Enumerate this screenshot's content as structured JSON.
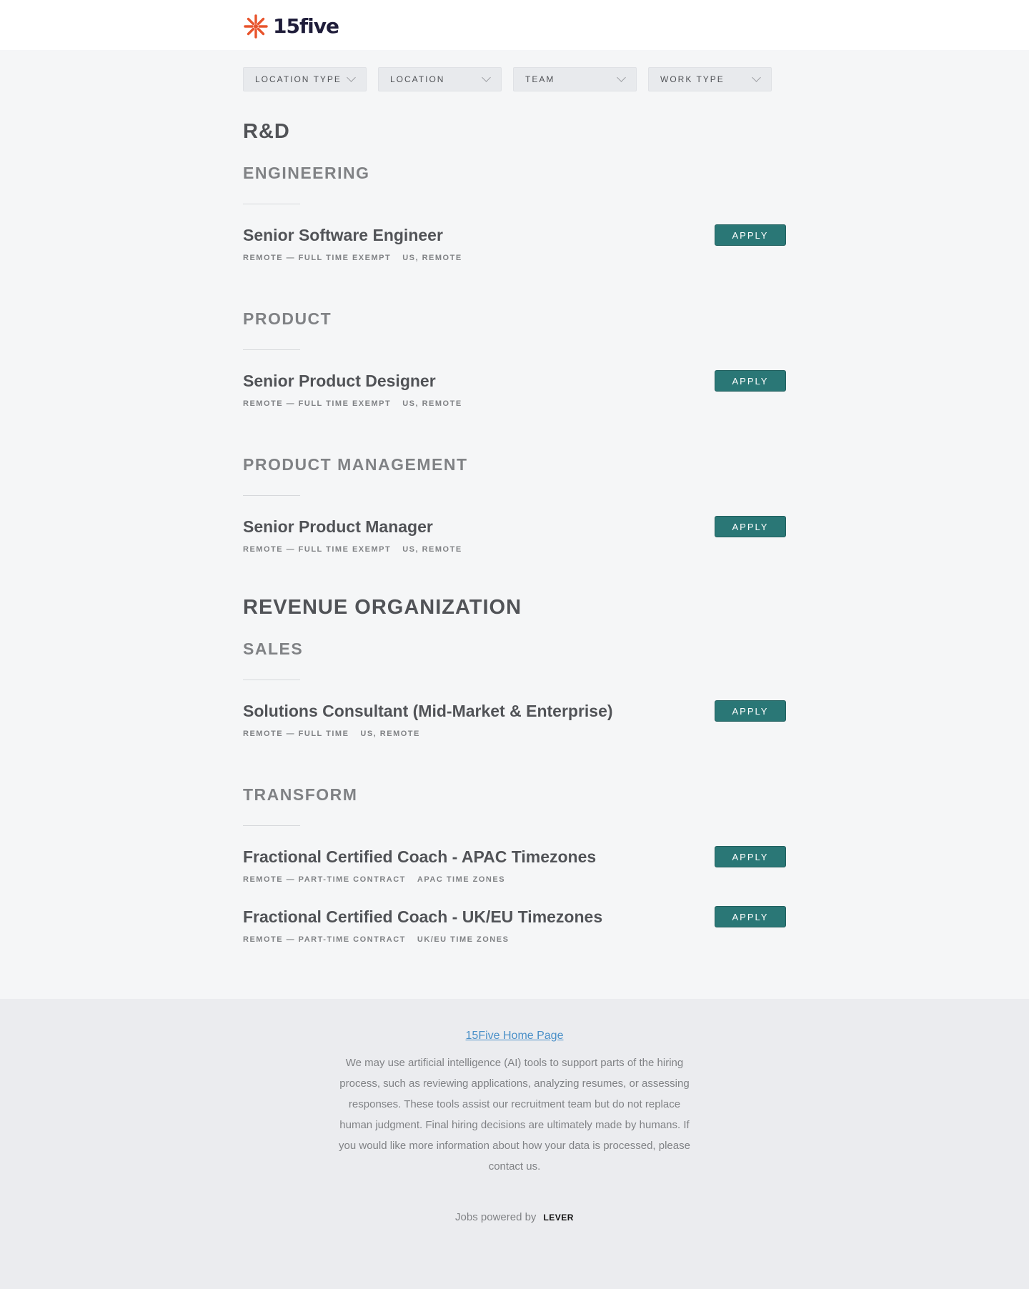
{
  "brand": {
    "name": "15five",
    "accent": "#e8542c"
  },
  "filters": [
    {
      "label": "LOCATION TYPE",
      "icon": "chevron-down-icon"
    },
    {
      "label": "LOCATION",
      "icon": "chevron-down-icon"
    },
    {
      "label": "TEAM",
      "icon": "chevron-down-icon"
    },
    {
      "label": "WORK TYPE",
      "icon": "chevron-down-icon"
    }
  ],
  "groups": [
    {
      "title": "R&D",
      "sections": [
        {
          "title": "ENGINEERING",
          "postings": [
            {
              "name": "Senior Software Engineer",
              "commitment": "REMOTE — FULL TIME EXEMPT",
              "location": "US, REMOTE",
              "apply": "APPLY"
            }
          ]
        },
        {
          "title": "PRODUCT",
          "postings": [
            {
              "name": "Senior Product Designer",
              "commitment": "REMOTE — FULL TIME EXEMPT",
              "location": "US, REMOTE",
              "apply": "APPLY"
            }
          ]
        },
        {
          "title": "PRODUCT MANAGEMENT",
          "postings": [
            {
              "name": "Senior Product Manager",
              "commitment": "REMOTE — FULL TIME EXEMPT",
              "location": "US, REMOTE",
              "apply": "APPLY"
            }
          ]
        }
      ]
    },
    {
      "title": "REVENUE ORGANIZATION",
      "sections": [
        {
          "title": "SALES",
          "postings": [
            {
              "name": "Solutions Consultant (Mid-Market & Enterprise)",
              "commitment": "REMOTE — FULL TIME",
              "location": "US, REMOTE",
              "apply": "APPLY"
            }
          ]
        },
        {
          "title": "TRANSFORM",
          "postings": [
            {
              "name": "Fractional Certified Coach - APAC Timezones",
              "commitment": "REMOTE — PART-TIME CONTRACT",
              "location": "APAC TIME ZONES",
              "apply": "APPLY"
            },
            {
              "name": "Fractional Certified Coach - UK/EU Timezones",
              "commitment": "REMOTE — PART-TIME CONTRACT",
              "location": "UK/EU TIME ZONES",
              "apply": "APPLY"
            }
          ]
        }
      ]
    }
  ],
  "footer": {
    "home_link": "15Five Home Page",
    "ai_notice": "We may use artificial intelligence (AI) tools to support parts of the hiring process, such as reviewing applications, analyzing resumes, or assessing responses. These tools assist our recruitment team but do not replace human judgment. Final hiring decisions are ultimately made by humans. If you would like more information about how your data is processed, please contact us.",
    "powered_by": "Jobs powered by",
    "lever_logo": "LEVER"
  },
  "colors": {
    "apply_button": "#2a7776",
    "link": "#4a90c8"
  }
}
